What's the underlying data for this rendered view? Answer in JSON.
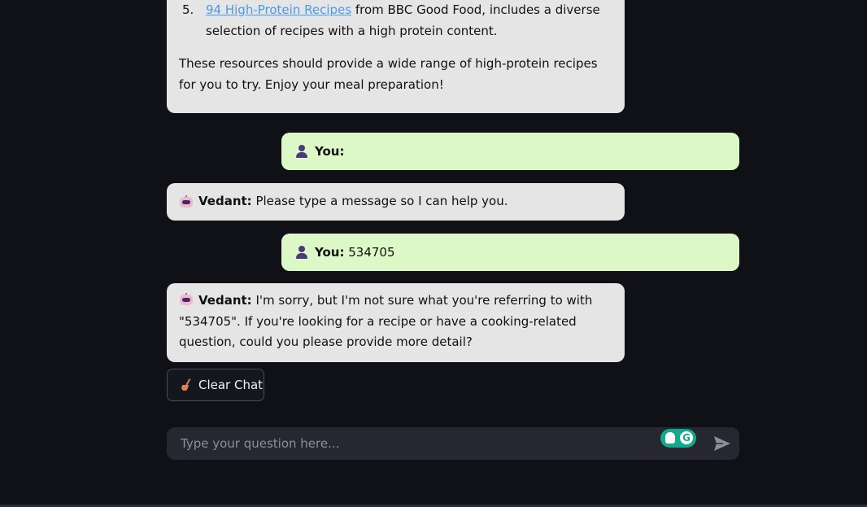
{
  "chat": {
    "bot_name": "Vedant:",
    "user_name": "You:",
    "first_bot_message": {
      "list_number": "5.",
      "link_text": "94 High-Protein Recipes",
      "link_after": " from BBC Good Food, includes a diverse selection of recipes with a high protein content.",
      "closing": "These resources should provide a wide range of high-protein recipes for you to try. Enjoy your meal preparation!"
    },
    "user_message_1": "",
    "bot_message_2": "Please type a message so I can help you.",
    "user_message_2": "534705",
    "bot_message_3": "I'm sorry, but I'm not sure what you're referring to with \"534705\". If you're looking for a recipe or have a cooking-related question, could you please provide more detail?"
  },
  "clear_button": {
    "label": "Clear Chat",
    "icon": "broom-icon"
  },
  "input": {
    "placeholder": "Type your question here...",
    "value": ""
  },
  "icons": {
    "bot": "robot-icon",
    "user": "user-icon",
    "send": "send-icon",
    "grammarly": "grammarly-icon"
  },
  "colors": {
    "background": "#0f1117",
    "bot_bubble": "#e5e5e5",
    "user_bubble": "#dcf8c6",
    "link": "#4a9ae8",
    "input_bg": "#262730",
    "grammarly": "#14a88c"
  }
}
